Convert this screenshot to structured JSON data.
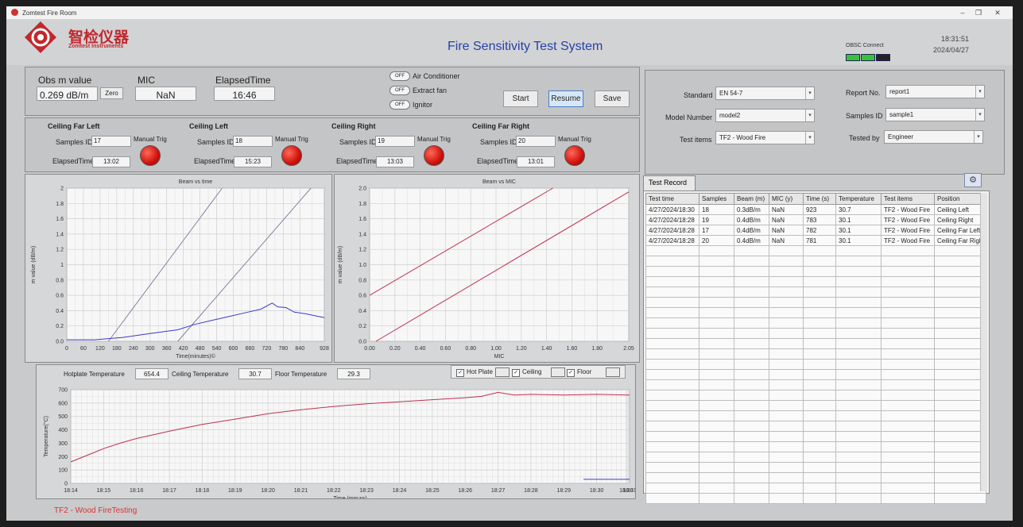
{
  "window": {
    "title": "Zomtest Fire Room",
    "min": "–",
    "max": "❐",
    "close": "✕"
  },
  "header": {
    "logo_cn": "智检仪器",
    "logo_en": "Zomtest Instruments",
    "title": "Fire Sensitivity Test System",
    "status_label": "OBSC Connect",
    "time": "18:31:51",
    "date": "2024/04/27"
  },
  "controls": {
    "obs_label": "Obs m value",
    "obs_value": "0.269 dB/m",
    "zero_label": "Zero",
    "mic_label": "MIC",
    "mic_value": "NaN",
    "elapsed_label": "ElapsedTime",
    "elapsed_value": "16:46",
    "toggles": [
      {
        "state": "OFF",
        "label": "Air Conditioner"
      },
      {
        "state": "OFF",
        "label": "Extract fan"
      },
      {
        "state": "OFF",
        "label": "Ignitor"
      }
    ],
    "start": "Start",
    "resume": "Resume",
    "save": "Save"
  },
  "positions": [
    {
      "title": "Ceiling Far Left",
      "samples_label": "Samples ID",
      "samples": "17",
      "elapsed_label": "ElapsedTime",
      "elapsed": "13:02",
      "trig": "Manual Trig"
    },
    {
      "title": "Ceiling Left",
      "samples_label": "Samples ID",
      "samples": "18",
      "elapsed_label": "ElapsedTime",
      "elapsed": "15:23",
      "trig": "Manual Trig"
    },
    {
      "title": "Ceiling Right",
      "samples_label": "Samples ID",
      "samples": "19",
      "elapsed_label": "ElapsedTime",
      "elapsed": "13:03",
      "trig": "Manual Trig"
    },
    {
      "title": "Ceiling Far Right",
      "samples_label": "Samples ID",
      "samples": "20",
      "elapsed_label": "ElapsedTime",
      "elapsed": "13:01",
      "trig": "Manual Trig"
    }
  ],
  "config": {
    "standard_label": "Standard",
    "standard": "EN 54-7",
    "model_label": "Model Number",
    "model": "model2",
    "test_items_label": "Test items",
    "test_items": "TF2 - Wood Fire",
    "report_label": "Report No.",
    "report": "report1",
    "samples_label": "Samples ID",
    "samples": "sample1",
    "tested_by_label": "Tested by",
    "tested_by": "Engineer"
  },
  "record": {
    "tab": "Test Record",
    "columns": [
      "Test time",
      "Samples",
      "Beam (m)",
      "MIC (y)",
      "Time (s)",
      "Temperature",
      "Test items",
      "Position"
    ],
    "rows": [
      [
        "4/27/2024/18:30",
        "18",
        "0.3dB/m",
        "NaN",
        "923",
        "30.7",
        "TF2 - Wood Fire",
        "Ceiling Left"
      ],
      [
        "4/27/2024/18:28",
        "19",
        "0.4dB/m",
        "NaN",
        "783",
        "30.1",
        "TF2 - Wood Fire",
        "Ceiling Right"
      ],
      [
        "4/27/2024/18:28",
        "17",
        "0.4dB/m",
        "NaN",
        "782",
        "30.1",
        "TF2 - Wood Fire",
        "Ceiling Far Left"
      ],
      [
        "4/27/2024/18:28",
        "20",
        "0.4dB/m",
        "NaN",
        "781",
        "30.1",
        "TF2 - Wood Fire",
        "Ceiling Far Righ"
      ]
    ]
  },
  "temps": {
    "hotplate_label": "Hotplate Temperature",
    "hotplate": "654.4",
    "ceiling_label": "Ceiling Temperature",
    "ceiling": "30.7",
    "floor_label": "Floor Temperature",
    "floor": "29.3",
    "legend": [
      "Hot Plate",
      "Ceiling",
      "Floor"
    ]
  },
  "status": "TF2 - Wood FireTesting",
  "chart_data": [
    {
      "type": "line",
      "title": "Beam vs time",
      "xlabel": "Time(minutes)©",
      "ylabel": "m value (dB/m)",
      "xlim": [
        0,
        928
      ],
      "ylim": [
        0,
        2.0
      ],
      "xticks": [
        0,
        60,
        120,
        180,
        240,
        300,
        360,
        420,
        480,
        540,
        600,
        660,
        720,
        780,
        840,
        928
      ],
      "yticks": [
        0,
        0.2,
        0.4,
        0.6,
        0.8,
        1.0,
        1.2,
        1.4,
        1.6,
        1.8,
        2.0
      ],
      "series": [
        {
          "color": "#8a7fa0",
          "x": [
            150,
            560
          ],
          "y": [
            0,
            2.0
          ]
        },
        {
          "color": "#8a7fa0",
          "x": [
            400,
            880
          ],
          "y": [
            0,
            2.0
          ]
        },
        {
          "color": "#3a3ad0",
          "x": [
            0,
            100,
            200,
            300,
            400,
            460,
            520,
            580,
            640,
            700,
            740,
            760,
            790,
            820,
            860,
            900,
            928
          ],
          "y": [
            0.02,
            0.02,
            0.05,
            0.1,
            0.15,
            0.22,
            0.27,
            0.32,
            0.37,
            0.42,
            0.5,
            0.45,
            0.44,
            0.38,
            0.36,
            0.33,
            0.31
          ]
        }
      ]
    },
    {
      "type": "line",
      "title": "Beam vs MIC",
      "xlabel": "MIC",
      "ylabel": "m value (dB/m)",
      "xlim": [
        0,
        2.05
      ],
      "ylim": [
        0,
        2.0
      ],
      "xticks": [
        0.0,
        0.2,
        0.4,
        0.6,
        0.8,
        1.0,
        1.2,
        1.4,
        1.6,
        1.8,
        2.05
      ],
      "xtick_labels": [
        "0.00",
        "0.20",
        "0.40",
        "0.60",
        "0.80",
        "1.00",
        "1.20",
        "1.40",
        "1.60",
        "1.80",
        "2.05"
      ],
      "yticks": [
        0,
        0.2,
        0.4,
        0.6,
        0.8,
        1.0,
        1.2,
        1.4,
        1.6,
        1.8,
        2.0
      ],
      "series": [
        {
          "color": "#c03050",
          "x": [
            0,
            1.45
          ],
          "y": [
            0.6,
            2.0
          ]
        },
        {
          "color": "#c03050",
          "x": [
            0.05,
            2.05
          ],
          "y": [
            0,
            1.95
          ]
        }
      ]
    },
    {
      "type": "line",
      "xlabel": "Time (mm:ss)",
      "ylabel": "Temperature(°C)",
      "xlim": [
        0,
        17
      ],
      "ylim": [
        0,
        700
      ],
      "xticks": [
        0,
        1,
        2,
        3,
        4,
        5,
        6,
        7,
        8,
        9,
        10,
        11,
        12,
        13,
        14,
        15,
        16,
        16.9,
        17
      ],
      "xtick_labels": [
        "18:14",
        "18:15",
        "18:16",
        "18:17",
        "18:18",
        "18:19",
        "18:20",
        "18:21",
        "18:22",
        "18:23",
        "18:24",
        "18:25",
        "18:26",
        "18:27",
        "18:28",
        "18:29",
        "18:30",
        "18:30",
        "18:31"
      ],
      "yticks": [
        0,
        100,
        200,
        300,
        400,
        500,
        600,
        700
      ],
      "series": [
        {
          "name": "Hot Plate",
          "color": "#c03050",
          "x": [
            0,
            0.5,
            1,
            1.5,
            2,
            3,
            4,
            5,
            6,
            7,
            8,
            9,
            10,
            11,
            12,
            12.5,
            13,
            13.5,
            14,
            15,
            16,
            17
          ],
          "y": [
            160,
            210,
            260,
            300,
            335,
            390,
            440,
            480,
            520,
            550,
            575,
            595,
            610,
            625,
            640,
            650,
            680,
            660,
            665,
            660,
            665,
            660
          ]
        },
        {
          "name": "Floor",
          "color": "#3a3ad0",
          "x": [
            15.6,
            17
          ],
          "y": [
            30,
            30
          ]
        }
      ]
    }
  ]
}
